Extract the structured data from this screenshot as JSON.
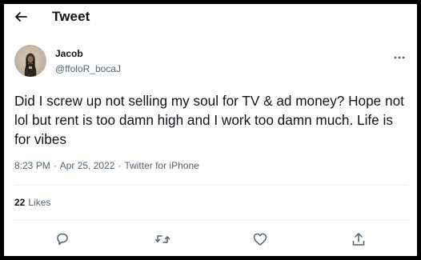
{
  "header": {
    "title": "Tweet",
    "back_icon": "arrow-left-icon"
  },
  "author": {
    "name": "Jacob",
    "handle": "@ffoloR_bocaJ"
  },
  "tweet": {
    "text": "Did I screw up not selling my soul for TV & ad money? Hope not lol but rent is too damn high and I work too damn much. Life is for vibes",
    "time": "8:23 PM",
    "date": "Apr 25, 2022",
    "source": "Twitter for iPhone",
    "separator": "·"
  },
  "stats": {
    "likes_count": "22",
    "likes_label": "Likes"
  },
  "actions": [
    "reply-icon",
    "retweet-icon",
    "like-icon",
    "share-icon"
  ],
  "colors": {
    "text": "#0f1419",
    "secondary": "#536471",
    "divider": "#eff3f4",
    "frame": "#000000"
  }
}
